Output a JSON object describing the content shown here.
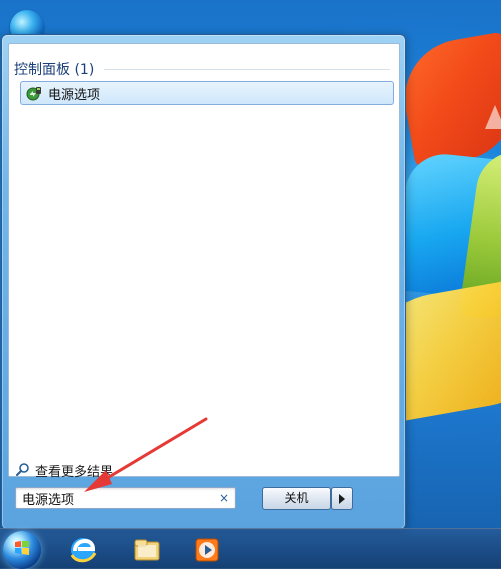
{
  "start_menu": {
    "group_title": "控制面板 (1)",
    "result_item_label": "电源选项",
    "see_more_label": "查看更多结果",
    "search_value": "电源选项",
    "search_clear": "×",
    "shutdown_label": "关机"
  },
  "taskbar": {
    "icons": [
      "start-orb",
      "internet-explorer-icon",
      "file-explorer-icon",
      "media-player-icon"
    ]
  },
  "colors": {
    "menu_frame": "#73b7e9",
    "selection": "#cfe7fb",
    "annotation_arrow": "#e53935"
  }
}
